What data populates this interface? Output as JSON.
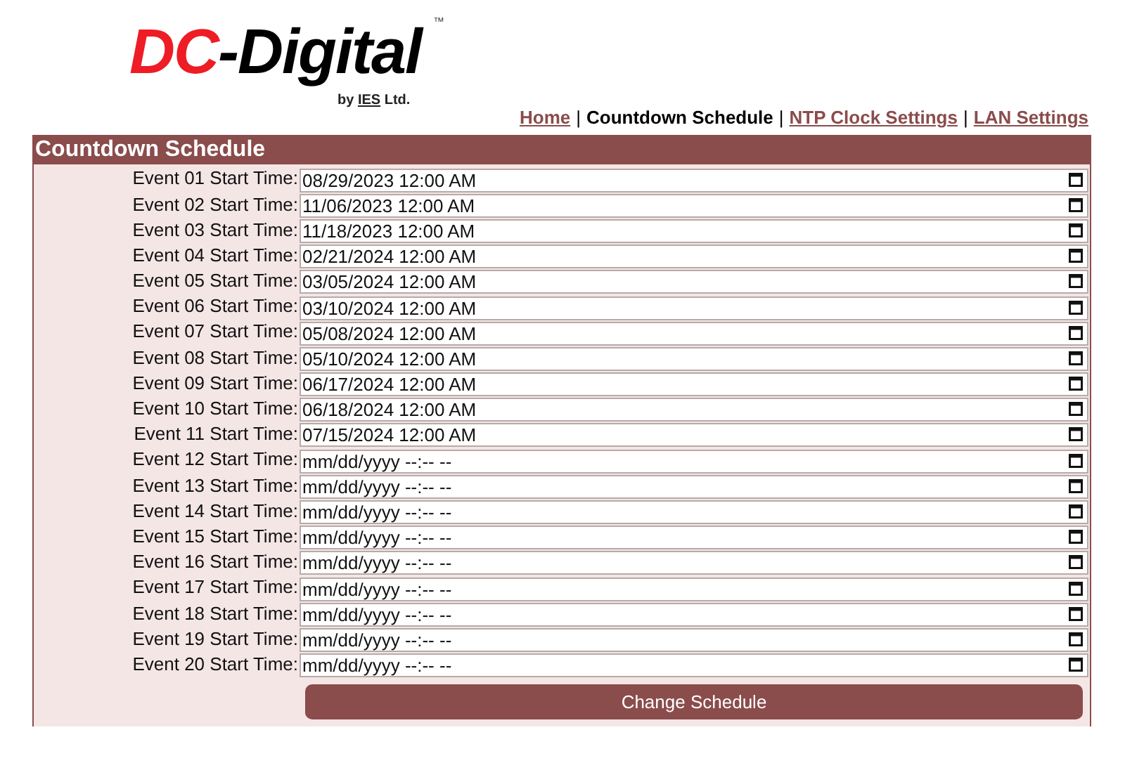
{
  "logo": {
    "first": "DC",
    "second": "-Digital",
    "trademark": "™",
    "byline_prefix": "by",
    "byline_brand": "IES",
    "byline_suffix": "Ltd."
  },
  "nav": {
    "separator": "|",
    "items": [
      {
        "label": "Home",
        "selected": false
      },
      {
        "label": "Countdown Schedule",
        "selected": true
      },
      {
        "label": "NTP Clock Settings",
        "selected": false
      },
      {
        "label": "LAN Settings",
        "selected": false
      }
    ]
  },
  "panel": {
    "title": "Countdown Schedule",
    "events": [
      {
        "label": "Event 01 Start Time:",
        "value": "08/29/2023 12:00 AM"
      },
      {
        "label": "Event 02 Start Time:",
        "value": "11/06/2023 12:00 AM"
      },
      {
        "label": "Event 03 Start Time:",
        "value": "11/18/2023 12:00 AM"
      },
      {
        "label": "Event 04 Start Time:",
        "value": "02/21/2024 12:00 AM"
      },
      {
        "label": "Event 05 Start Time:",
        "value": "03/05/2024 12:00 AM"
      },
      {
        "label": "Event 06 Start Time:",
        "value": "03/10/2024 12:00 AM"
      },
      {
        "label": "Event 07 Start Time:",
        "value": "05/08/2024 12:00 AM"
      },
      {
        "label": "Event 08 Start Time:",
        "value": "05/10/2024 12:00 AM"
      },
      {
        "label": "Event 09 Start Time:",
        "value": "06/17/2024 12:00 AM"
      },
      {
        "label": "Event 10 Start Time:",
        "value": "06/18/2024 12:00 AM"
      },
      {
        "label": "Event 11 Start Time:",
        "value": "07/15/2024 12:00 AM"
      },
      {
        "label": "Event 12 Start Time:",
        "placeholder": "mm/dd/yyyy --:-- --"
      },
      {
        "label": "Event 13 Start Time:",
        "placeholder": "mm/dd/yyyy --:-- --"
      },
      {
        "label": "Event 14 Start Time:",
        "placeholder": "mm/dd/yyyy --:-- --"
      },
      {
        "label": "Event 15 Start Time:",
        "placeholder": "mm/dd/yyyy --:-- --"
      },
      {
        "label": "Event 16 Start Time:",
        "placeholder": "mm/dd/yyyy --:-- --"
      },
      {
        "label": "Event 17 Start Time:",
        "placeholder": "mm/dd/yyyy --:-- --"
      },
      {
        "label": "Event 18 Start Time:",
        "placeholder": "mm/dd/yyyy --:-- --"
      },
      {
        "label": "Event 19 Start Time:",
        "placeholder": "mm/dd/yyyy --:-- --"
      },
      {
        "label": "Event 20 Start Time:",
        "placeholder": "mm/dd/yyyy --:-- --"
      }
    ],
    "button": "Change Schedule"
  }
}
